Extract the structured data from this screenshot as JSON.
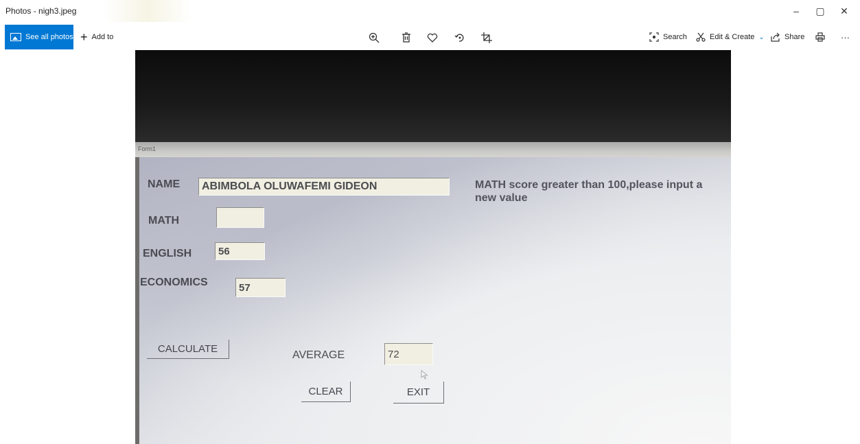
{
  "window": {
    "title": "Photos - nigh3.jpeg",
    "controls": [
      "–",
      "▢",
      "✕"
    ]
  },
  "toolbar": {
    "see_all_label": "See all photos",
    "add_to_label": "Add to",
    "center_icons": [
      "zoom-in-icon",
      "delete-icon",
      "heart-icon",
      "rotate-icon",
      "crop-icon"
    ],
    "search_label": "Search",
    "edit_create_label": "Edit & Create",
    "share_label": "Share",
    "more_label": "···",
    "accent": "#0078d4"
  },
  "photo": {
    "form_title": "Form1",
    "labels": {
      "name": "NAME",
      "math": "MATH",
      "english": "ENGLISH",
      "economics": "ECONOMICS",
      "average": "AVERAGE"
    },
    "values": {
      "name": "ABIMBOLA OLUWAFEMI GIDEON",
      "math": "",
      "english": "56",
      "economics": "57",
      "average": "72"
    },
    "buttons": {
      "calculate": "CALCULATE",
      "clear": "CLEAR",
      "exit": "EXIT"
    },
    "message": "MATH score greater than 100,please input a new value"
  }
}
